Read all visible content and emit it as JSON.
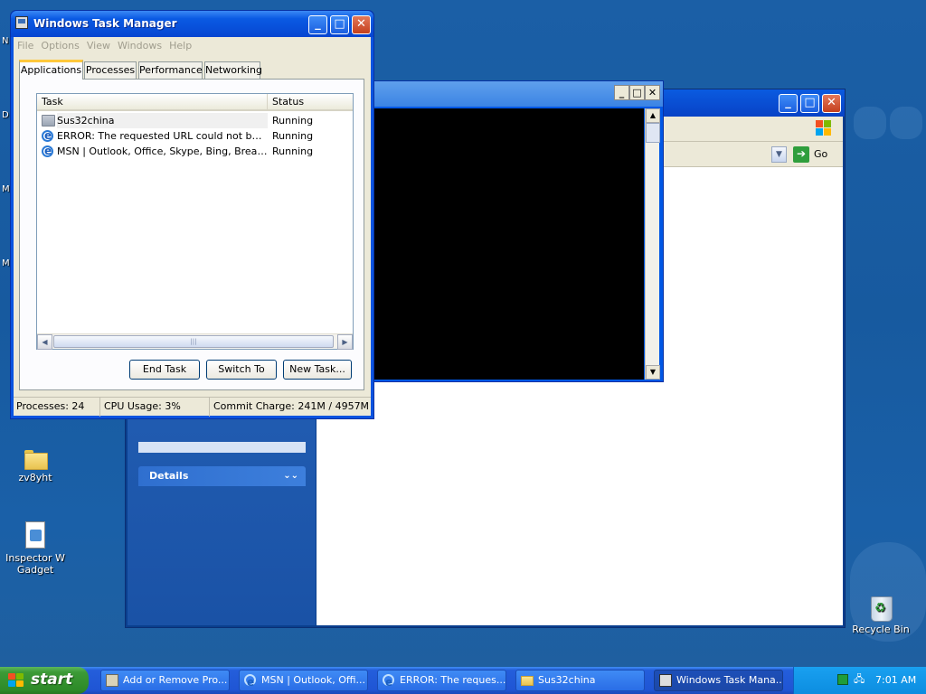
{
  "desktop": {
    "icons": [
      {
        "label": "zv8yht"
      },
      {
        "label": "Inspector W Gadget"
      },
      {
        "label": "Recycle Bin"
      }
    ],
    "edge_labels": [
      "N",
      "D",
      "M",
      "M"
    ]
  },
  "bg_window": {
    "go_label": "Go",
    "details_label": "Details"
  },
  "task_manager": {
    "title": "Windows Task Manager",
    "menu": [
      "File",
      "Options",
      "View",
      "Windows",
      "Help"
    ],
    "tabs": [
      "Applications",
      "Processes",
      "Performance",
      "Networking"
    ],
    "active_tab": "Applications",
    "columns": {
      "task": "Task",
      "status": "Status"
    },
    "rows": [
      {
        "task": "Sus32china",
        "status": "Running",
        "icon": "folder-icon"
      },
      {
        "task": "ERROR: The requested URL could not be retrieved",
        "status": "Running",
        "icon": "ie-icon"
      },
      {
        "task": "MSN | Outlook, Office, Skype, Bing, Breaking News",
        "status": "Running",
        "icon": "ie-icon"
      }
    ],
    "buttons": {
      "end_task": "End Task",
      "switch_to": "Switch To",
      "new_task": "New Task..."
    },
    "status": {
      "processes": "Processes: 24",
      "cpu": "CPU Usage: 3%",
      "commit": "Commit Charge: 241M / 4957M"
    }
  },
  "taskbar": {
    "start_label": "start",
    "items": [
      {
        "label": "Add or Remove Pro...",
        "icon": "control-panel-icon"
      },
      {
        "label": "MSN | Outlook, Offi...",
        "icon": "ie-icon"
      },
      {
        "label": "ERROR: The reques...",
        "icon": "ie-icon"
      },
      {
        "label": "Sus32china",
        "icon": "folder-icon"
      },
      {
        "label": "Windows Task Mana...",
        "icon": "task-manager-icon"
      }
    ],
    "clock": "7:01 AM"
  }
}
